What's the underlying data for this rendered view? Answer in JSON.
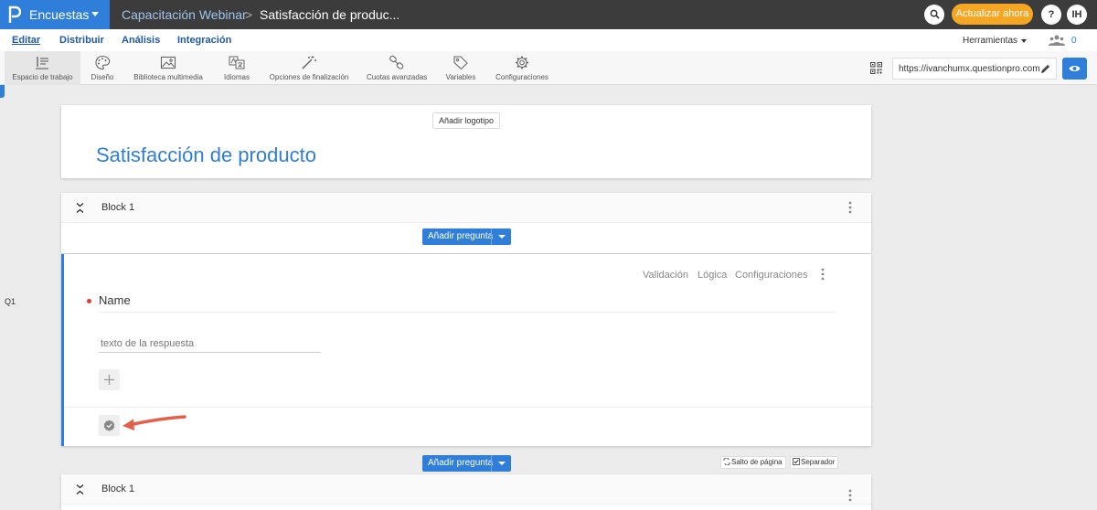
{
  "app": {
    "name": "Encuestas"
  },
  "breadcrumb": {
    "folder": "Capacitación Webinar",
    "separator": ">",
    "survey": "Satisfacción de produc..."
  },
  "header": {
    "upgrade": "Actualizar ahora",
    "help": "?",
    "user_initials": "IH"
  },
  "menu": {
    "items": [
      {
        "label": "Editar",
        "active": true
      },
      {
        "label": "Distribuir"
      },
      {
        "label": "Análisis"
      },
      {
        "label": "Integración"
      }
    ],
    "tools": "Herramientas",
    "collaborators": "0"
  },
  "toolbar": {
    "items": [
      {
        "label": "Espacio de trabajo",
        "icon": "workspace-icon",
        "active": true
      },
      {
        "label": "Diseño",
        "icon": "palette-icon"
      },
      {
        "label": "Biblioteca multimedia",
        "icon": "image-icon"
      },
      {
        "label": "Idiomas",
        "icon": "translate-icon"
      },
      {
        "label": "Opciones de finalización",
        "icon": "magic-wand-icon"
      },
      {
        "label": "Cuotas avanzadas",
        "icon": "link-chain-icon"
      },
      {
        "label": "Variables",
        "icon": "tag-icon"
      },
      {
        "label": "Configuraciones",
        "icon": "gear-icon"
      }
    ],
    "url": "https://ivanchumx.questionpro.com"
  },
  "survey": {
    "add_logo": "Añadir logotipo",
    "title": "Satisfacción de producto"
  },
  "blocks": [
    {
      "title": "Block 1",
      "add_question": "Añadir pregunta"
    },
    {
      "title": "Block 1"
    }
  ],
  "question": {
    "number": "Q1",
    "links": [
      "Validación",
      "Lógica",
      "Configuraciones"
    ],
    "text": "Name",
    "required": true,
    "answer_placeholder": "texto de la respuesta"
  },
  "footer_actions": {
    "add_question": "Añadir pregunta",
    "page_break": "Salto de página",
    "separator": "Separador"
  },
  "colors": {
    "accent": "#2f7ed9",
    "topbar": "#3c3c3c",
    "upgrade": "#f5a623",
    "required": "#e53935",
    "annotation_arrow": "#e2614b"
  }
}
